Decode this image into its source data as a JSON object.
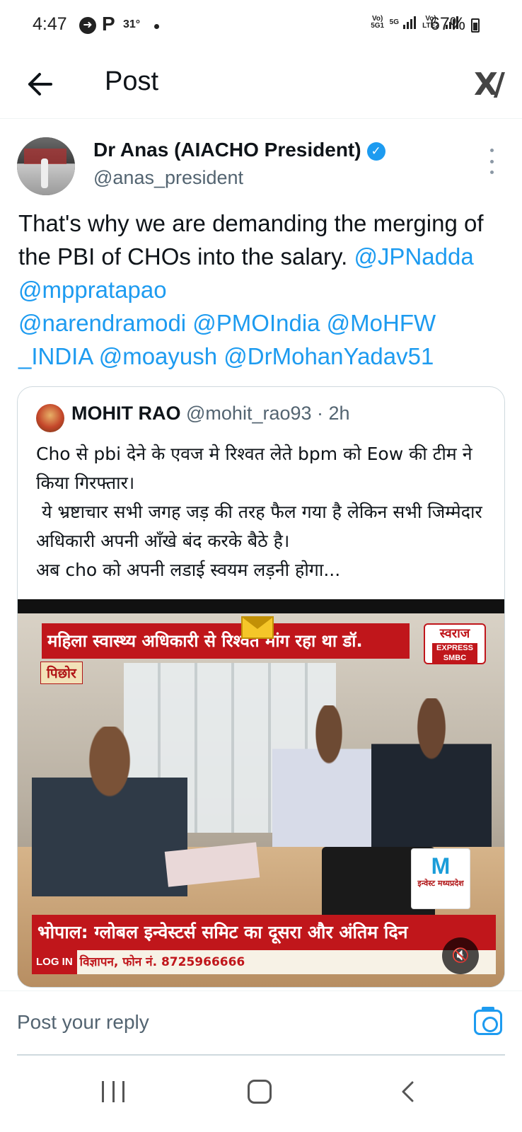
{
  "status_bar": {
    "time": "4:47",
    "notif_icon": "P",
    "temperature": "31°",
    "network_1": "Vo) 5G1",
    "network_5g": "5G",
    "network_2": "Vo) LTE2",
    "battery": "67%"
  },
  "header": {
    "title": "Post",
    "back_icon": "arrow-left-icon",
    "logo_icon": "x-logo-icon"
  },
  "tweet": {
    "author_name": "Dr Anas (AIACHO President)",
    "author_handle": "@anas_president",
    "verified": true,
    "text": "That's why we are demanding the merging of the PBI of CHOs into the salary.",
    "mentions": [
      "@JPNadda",
      "@mppratapao",
      "@narendramodi",
      "@PMOIndia",
      "@MoHFW_INDIA",
      "@moayush",
      "@DrMohanYadav51"
    ],
    "mention_line_1": "@JPNadda @mppratapao",
    "mention_line_2": "@narendramodi @PMOIndia @MoHFW",
    "mention_line_3": "_INDIA @moayush @DrMohanYadav51"
  },
  "quoted_tweet": {
    "author_name": "MOHIT RAO",
    "author_handle": "@mohit_rao93",
    "time": "· 2h",
    "text": "Cho से pbi देने के एवज मे रिश्वत लेते bpm को Eow की टीम ने किया गिरफ्तार।\n ये भ्रष्टाचार सभी जगह जड़ की तरह फैल गया है लेकिन सभी जिम्मेदार अधिकारी अपनी आँखे बंद करके बैठे है।\nअब cho को अपनी लडाई स्वयम लड़नी होगा..."
  },
  "video": {
    "headline": "महिला स्वास्थ्य अधिकारी से रिश्वत मांग रहा था डॉ.",
    "place": "पिछोर",
    "channel_name": "स्वराज",
    "channel_sub": "EXPRESS SMBC",
    "badge_letter": "M",
    "badge_text": "इन्वेस्ट मध्यप्रदेश",
    "ticker": "भोपाल: ग्लोबल इन्वेस्टर्स समिट का दूसरा और अंतिम दिन",
    "login_label": "LOG IN",
    "ad_text": "विज्ञापन, फोन नं. 8725966666",
    "mute_icon": "mute-icon"
  },
  "reply": {
    "placeholder": "Post your reply",
    "camera_icon": "camera-icon"
  },
  "colors": {
    "accent": "#1d9bf0",
    "text_primary": "#0f1419",
    "text_secondary": "#536471",
    "news_red": "#c0161b"
  }
}
